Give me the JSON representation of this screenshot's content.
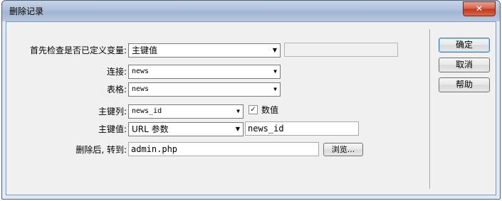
{
  "window": {
    "title": "删除记录",
    "close_glyph": "✕"
  },
  "form": {
    "check_variable": {
      "label": "首先检查是否已定义变量:",
      "selected": "主键值",
      "value": ""
    },
    "connection": {
      "label": "连接:",
      "selected": "news"
    },
    "table": {
      "label": "表格:",
      "selected": "news"
    },
    "primary_key_column": {
      "label": "主键列:",
      "selected": "news_id",
      "numeric_checked": true,
      "numeric_label": "数值"
    },
    "primary_key_value": {
      "label": "主键值:",
      "selected": "URL 参数",
      "value": "news_id"
    },
    "redirect": {
      "label": "删除后, 转到:",
      "value": "admin.php",
      "browse_label": "浏览..."
    }
  },
  "buttons": {
    "ok": "确定",
    "cancel": "取消",
    "help": "帮助"
  },
  "icons": {
    "dropdown": "▼",
    "check": "✓"
  }
}
